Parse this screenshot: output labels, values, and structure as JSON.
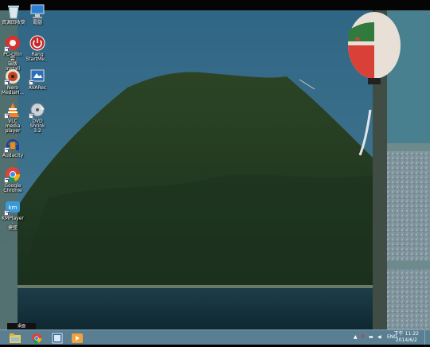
{
  "desktop_icons": [
    {
      "label": "資源回收筒",
      "icon": "recycle-bin-icon"
    },
    {
      "label": "電腦",
      "icon": "computer-icon"
    },
    {
      "label": "PC-cillin 雲\n端版 Install",
      "icon": "pc-cillin-icon"
    },
    {
      "label": "Rang\nStartMe...",
      "icon": "power-icon"
    },
    {
      "label": "Nero\nMediaH...",
      "icon": "nero-icon"
    },
    {
      "label": "AVARec",
      "icon": "avarec-icon"
    },
    {
      "label": "VLC media\nplayer",
      "icon": "vlc-icon"
    },
    {
      "label": "DVD Shrink\n3.2",
      "icon": "dvd-shrink-icon"
    },
    {
      "label": "Audacity",
      "icon": "audacity-icon"
    },
    {
      "label": "Google\nChrome",
      "icon": "chrome-icon"
    },
    {
      "label": "KMPlayer -\n捷徑",
      "icon": "kmplayer-icon"
    }
  ],
  "taskbar": {
    "start_tip": "桌面",
    "pinned": [
      "file-explorer-icon",
      "chrome-icon",
      "media-player-icon",
      "kmplayer-icon"
    ],
    "tray": {
      "language": "ENG",
      "time": "下午 11:22",
      "date": "2014/6/2"
    }
  },
  "colors": {
    "sky": "#3e6f8c",
    "taskbar": "#5a7f92",
    "mountain": "#1f3620"
  }
}
